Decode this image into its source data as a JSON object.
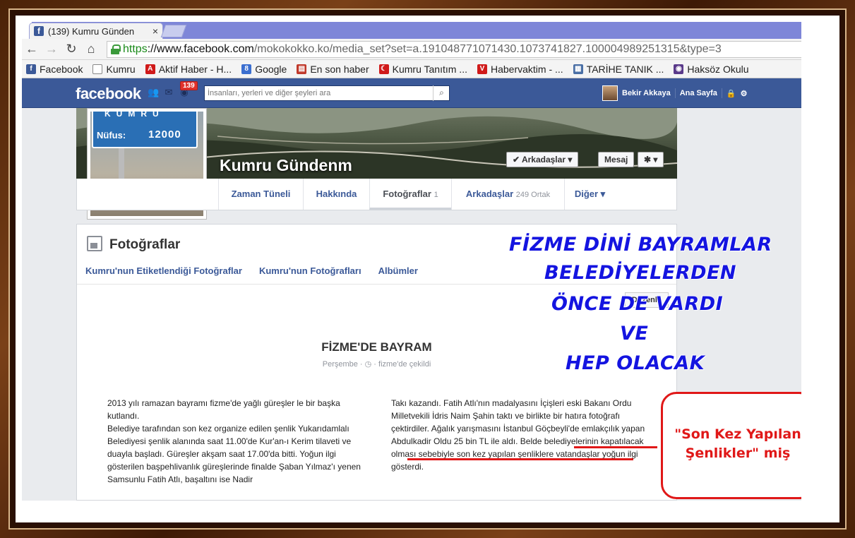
{
  "browser": {
    "tab_title": "(139) Kumru Günden",
    "tab_close": "×",
    "url_https": "https",
    "url_host": "://www.facebook.com",
    "url_path": "/mokokokko.ko/media_set?set=a.191048771071430.1073741827.100004989251315&type=3",
    "nav": {
      "back": "←",
      "forward": "→",
      "reload": "↻",
      "home": "⌂"
    }
  },
  "bookmarks": [
    {
      "label": "Facebook",
      "icon": "facebook-icon",
      "glyph": "f",
      "color": "#3b5998"
    },
    {
      "label": "Kumru",
      "icon": "page-icon",
      "glyph": "",
      "color": "#ffffff"
    },
    {
      "label": "Aktif Haber - H...",
      "icon": "aktif-haber-icon",
      "glyph": "A",
      "color": "#d01a1a"
    },
    {
      "label": "Google",
      "icon": "google-icon",
      "glyph": "8",
      "color": "#3b6fd0"
    },
    {
      "label": "En son haber",
      "icon": "news-icon",
      "glyph": "▤",
      "color": "#c0392b"
    },
    {
      "label": "Kumru Tanıtım ...",
      "icon": "turkey-flag-icon",
      "glyph": "☾",
      "color": "#d01a1a"
    },
    {
      "label": "Habervaktim - ...",
      "icon": "habervaktim-icon",
      "glyph": "V",
      "color": "#d01a1a"
    },
    {
      "label": "TARİHE TANIK ...",
      "icon": "tarihe-tanik-icon",
      "glyph": "▦",
      "color": "#4a6fa5"
    },
    {
      "label": "Haksöz Okulu",
      "icon": "haksoz-icon",
      "glyph": "◉",
      "color": "#5a3a8a"
    }
  ],
  "facebook": {
    "logo": "facebook",
    "notifications_count": "139",
    "search_placeholder": "İnsanları, yerleri ve diğer şeyleri ara",
    "user_name": "Bekir Akkaya",
    "home_label": "Ana Sayfa"
  },
  "profile": {
    "page_name": "Kumru Gündenm",
    "sign_top": "KUMRU",
    "sign_label": "Nüfus:",
    "sign_number": "12000",
    "friends_button": "✔ Arkadaşlar",
    "message_button": "Mesaj"
  },
  "timeline_tabs": [
    {
      "label": "Zaman Tüneli",
      "count": ""
    },
    {
      "label": "Hakkında",
      "count": ""
    },
    {
      "label": "Fotoğraflar",
      "count": "1"
    },
    {
      "label": "Arkadaşlar",
      "count": "249 Ortak"
    },
    {
      "label": "Diğer",
      "count": ""
    }
  ],
  "photos": {
    "title": "Fotoğraflar",
    "links": [
      "Kumru'nun Etiketlendiği Fotoğraflar",
      "Kumru'nun Fotoğrafları",
      "Albümler"
    ],
    "edit_button": "Düzenle"
  },
  "note": {
    "title": "FİZME'DE BAYRAM",
    "meta": "Perşembe · ◷ · fizme'de çekildi",
    "left_text": "2013 yılı ramazan bayramı fizme'de yağlı güreşler le bir başka kutlandı.\nBelediye tarafından son kez organize edilen şenlik Yukarıdamlalı Belediyesi şenlik alanında saat 11.00'de Kur'an-ı Kerim tilaveti ve duayla başladı. Güreşler akşam saat 17.00'da bitti. Yoğun ilgi gösterilen başpehlivanlık güreşlerinde finalde Şaban Yılmaz'ı yenen Samsunlu Fatih Atlı, başaltını ise Nadir",
    "right_text": "Takı kazandı. Fatih Atlı'nın madalyasını İçişleri eski Bakanı Ordu Milletvekili İdris Naim Şahin taktı ve birlikte bir hatıra fotoğrafı çektirdiler. Ağalık yarışmasını İstanbul Göçbeyli'de emlakçılık yapan Abdulkadir Oldu 25 bin TL ile aldı. Belde belediyelerinin kapatılacak olması sebebiyle son kez yapılan şenliklere vatandaşlar yoğun ilgi gösterdi."
  },
  "overlay": {
    "headline_lines": [
      "FİZME DİNİ BAYRAMLAR",
      "BELEDİYELERDEN",
      "ÖNCE DE VARDI",
      "VE",
      "HEP OLACAK"
    ],
    "callout_line1": "\"Son Kez Yapılan",
    "callout_line2": "Şenlikler\" miş",
    "headline_color": "#1414e0",
    "callout_color": "#e01818"
  }
}
